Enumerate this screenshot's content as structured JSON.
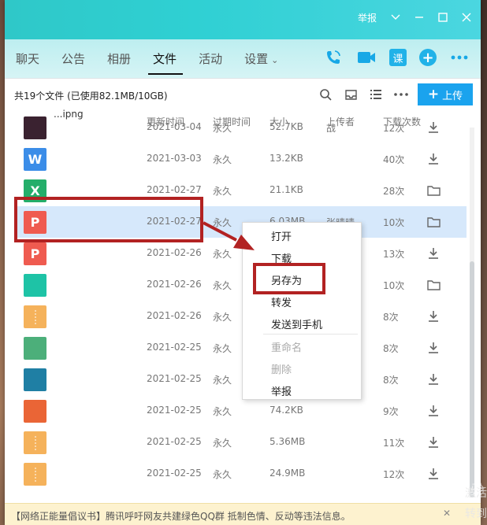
{
  "titlebar": {
    "report_label": "举报"
  },
  "tabs": [
    {
      "label": "聊天",
      "active": false
    },
    {
      "label": "公告",
      "active": false
    },
    {
      "label": "相册",
      "active": false
    },
    {
      "label": "文件",
      "active": true
    },
    {
      "label": "活动",
      "active": false
    },
    {
      "label": "设置",
      "active": false,
      "dropdown": true
    }
  ],
  "nav_icons": {
    "course_label": "课"
  },
  "toolbar": {
    "summary": "共19个文件 (已使用82.1MB/10GB)",
    "upload_label": "上传"
  },
  "columns": [
    "文件",
    "更新时间",
    "过期时间",
    "大小",
    "上传者",
    "下载次数"
  ],
  "rows": [
    {
      "icon_color": "#3a2230",
      "icon_glyph": "",
      "name": "...ipng",
      "updated": "2021-03-04",
      "expire": "永久",
      "size": "52.7KB",
      "uploader": "战",
      "downloads": "12次",
      "action": "download",
      "selected": false
    },
    {
      "icon_color": "#3b8de8",
      "icon_glyph": "W",
      "name": "",
      "updated": "2021-03-03",
      "expire": "永久",
      "size": "13.2KB",
      "uploader": "",
      "downloads": "40次",
      "action": "download",
      "selected": false
    },
    {
      "icon_color": "#24ae6a",
      "icon_glyph": "X",
      "name": "",
      "updated": "2021-02-27",
      "expire": "永久",
      "size": "21.1KB",
      "uploader": "",
      "downloads": "28次",
      "action": "folder",
      "selected": false
    },
    {
      "icon_color": "#ef5b50",
      "icon_glyph": "P",
      "name": "",
      "updated": "2021-02-27",
      "expire": "永久",
      "size": "6.03MB",
      "uploader": "张晴晴",
      "downloads": "10次",
      "action": "folder",
      "selected": true
    },
    {
      "icon_color": "#ef5b50",
      "icon_glyph": "P",
      "name": "",
      "updated": "2021-02-26",
      "expire": "永久",
      "size": "",
      "uploader": "",
      "downloads": "13次",
      "action": "download",
      "selected": false
    },
    {
      "icon_color": "#1ec3a6",
      "icon_glyph": "",
      "name": "",
      "updated": "2021-02-26",
      "expire": "永久",
      "size": "",
      "uploader": "",
      "downloads": "10次",
      "action": "folder",
      "selected": false
    },
    {
      "icon_color": "#f5b25b",
      "icon_glyph": "",
      "name": "",
      "updated": "2021-02-26",
      "expire": "永久",
      "size": "",
      "uploader": "",
      "downloads": "8次",
      "action": "download",
      "selected": false
    },
    {
      "icon_color": "#4caf7a",
      "icon_glyph": "",
      "name": "",
      "updated": "2021-02-25",
      "expire": "永久",
      "size": "",
      "uploader": "",
      "downloads": "8次",
      "action": "download",
      "selected": false
    },
    {
      "icon_color": "#1f7fa4",
      "icon_glyph": "",
      "name": "",
      "updated": "2021-02-25",
      "expire": "永久",
      "size": "",
      "uploader": "",
      "downloads": "8次",
      "action": "download",
      "selected": false
    },
    {
      "icon_color": "#ea6536",
      "icon_glyph": "",
      "name": "",
      "updated": "2021-02-25",
      "expire": "永久",
      "size": "74.2KB",
      "uploader": "",
      "downloads": "9次",
      "action": "download",
      "selected": false
    },
    {
      "icon_color": "#f5b25b",
      "icon_glyph": "",
      "name": "",
      "updated": "2021-02-25",
      "expire": "永久",
      "size": "5.36MB",
      "uploader": "",
      "downloads": "11次",
      "action": "download",
      "selected": false
    },
    {
      "icon_color": "#f5b25b",
      "icon_glyph": "",
      "name": "",
      "updated": "2021-02-25",
      "expire": "永久",
      "size": "24.9MB",
      "uploader": "",
      "downloads": "12次",
      "action": "download",
      "selected": false
    }
  ],
  "context_menu": {
    "open": "打开",
    "download": "下载",
    "save_as": "另存为",
    "forward": "转发",
    "send_to_phone": "发送到手机",
    "rename": "重命名",
    "delete": "删除",
    "report": "举报"
  },
  "bottom_bar": {
    "text": "【网络正能量倡议书】腾讯呼吁网友共建绿色QQ群 抵制色情、反动等违法信息。"
  },
  "watermark": {
    "text": "Baidu 经验",
    "side_text_1": "激活",
    "side_text_2": "转到"
  }
}
